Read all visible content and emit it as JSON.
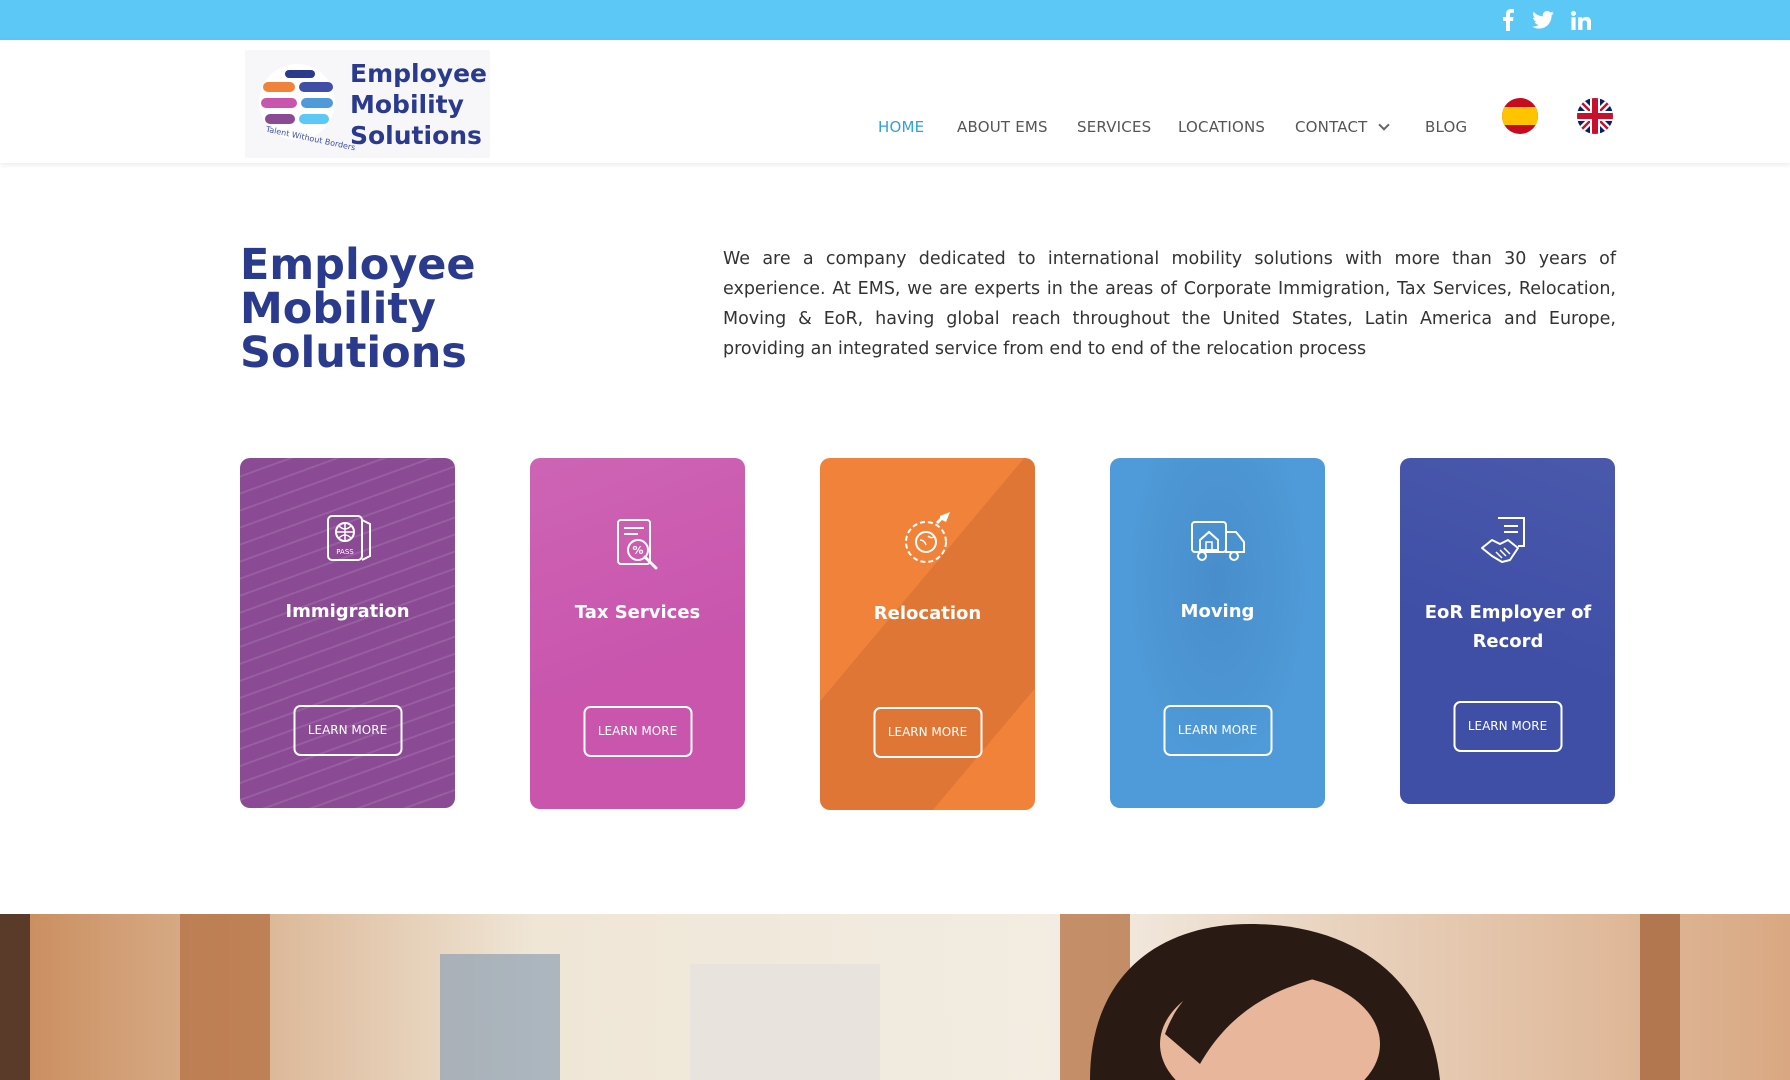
{
  "topbar": {
    "color": "#5bc8f5",
    "social": [
      {
        "name": "facebook-icon"
      },
      {
        "name": "twitter-icon"
      },
      {
        "name": "linkedin-icon"
      }
    ]
  },
  "logo": {
    "lines": [
      "Employee",
      "Mobility",
      "Solutions"
    ],
    "tagline": "Talent Without Borders"
  },
  "nav": {
    "items": [
      {
        "label": "HOME",
        "active": true
      },
      {
        "label": "ABOUT EMS",
        "active": false
      },
      {
        "label": "SERVICES",
        "active": false
      },
      {
        "label": "LOCATIONS",
        "active": false
      },
      {
        "label": "CONTACT",
        "active": false,
        "has_dropdown": true
      },
      {
        "label": "BLOG",
        "active": false
      }
    ],
    "active_color": "#2ea3d6",
    "languages": [
      {
        "name": "spain-flag-icon"
      },
      {
        "name": "uk-flag-icon"
      }
    ]
  },
  "intro": {
    "title_lines": [
      "Employee",
      "Mobility",
      "Solutions"
    ],
    "title_color": "#2a3a8c",
    "text": "We are a company dedicated to international mobility solutions with more than 30 years of experience. At EMS, we are experts in the areas of Corporate Immigration, Tax Services, Relocation, Moving & EoR, having global reach throughout the United States, Latin America and Europe, providing an integrated service from end to end of the relocation process"
  },
  "cards": [
    {
      "title": "Immigration",
      "button": "LEARN MORE",
      "color": "#8a4a94",
      "icon": "passport-icon"
    },
    {
      "title": "Tax Services",
      "button": "LEARN MORE",
      "color": "#c955ad",
      "icon": "tax-document-icon"
    },
    {
      "title": "Relocation",
      "button": "LEARN MORE",
      "color": "#f0823a",
      "icon": "globe-plane-icon"
    },
    {
      "title": "Moving",
      "button": "LEARN MORE",
      "color": "#4f9ad8",
      "icon": "moving-truck-icon"
    },
    {
      "title": "EoR  Employer of Record",
      "button": "LEARN MORE",
      "color": "#3f4fa6",
      "icon": "handshake-contract-icon"
    }
  ]
}
